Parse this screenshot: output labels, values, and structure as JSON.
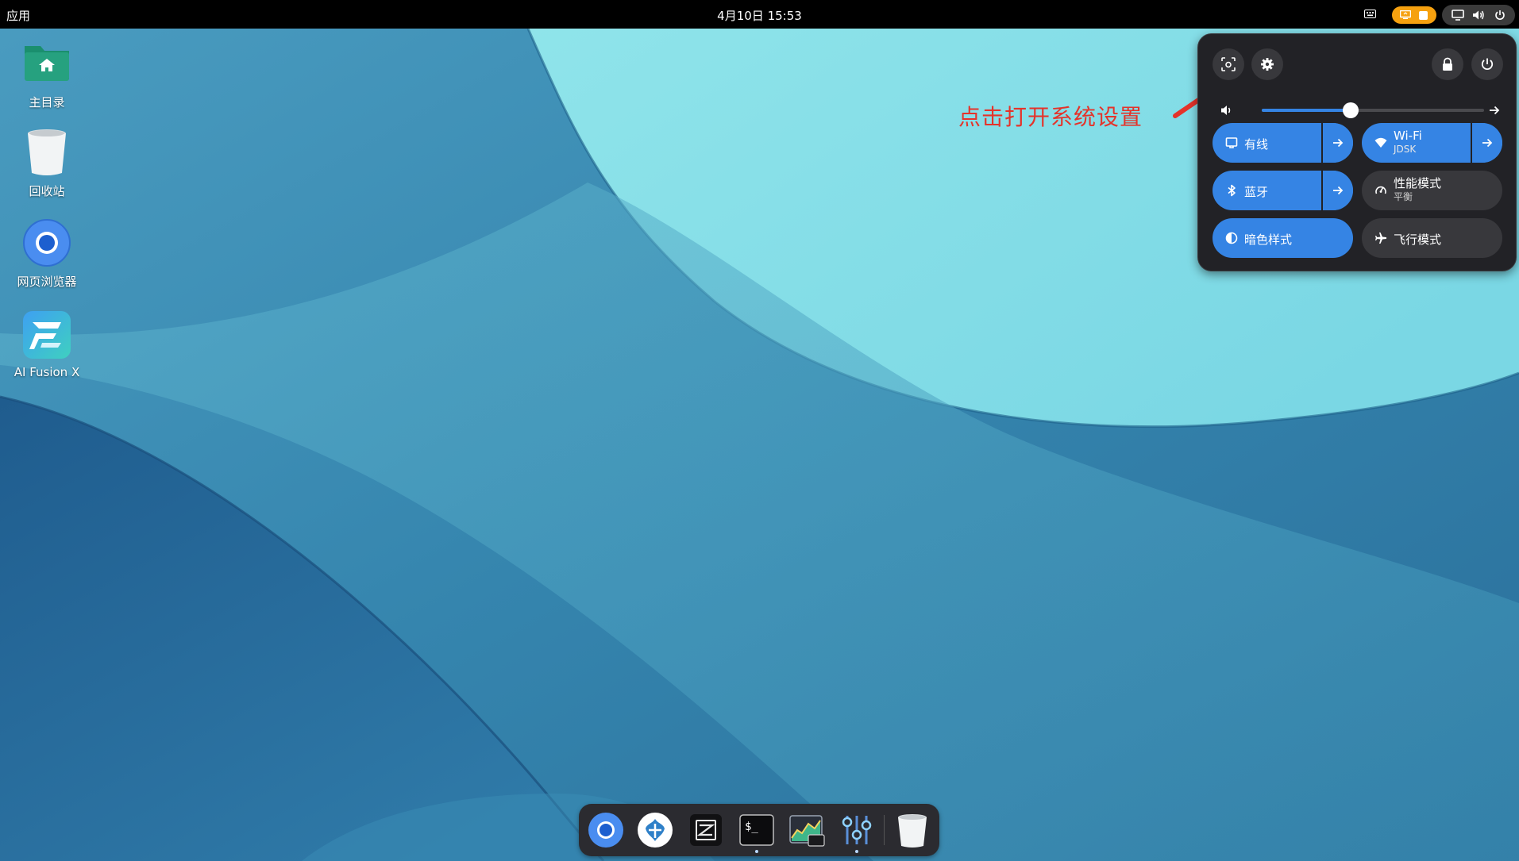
{
  "topbar": {
    "apps_label": "应用",
    "clock": "4月10日  15:53",
    "indicators": [
      "keyboard-icon",
      "screen-share-icon",
      "record-stop-icon",
      "display-icon",
      "volume-icon",
      "power-icon"
    ],
    "accent_color": "#f6a10f"
  },
  "desktop": {
    "icons": [
      {
        "label": "主目录",
        "icon": "home-folder-icon"
      },
      {
        "label": "回收站",
        "icon": "trash-icon"
      },
      {
        "label": "网页浏览器",
        "icon": "chrome-icon"
      },
      {
        "label": "AI Fusion X",
        "icon": "ai-fusion-x-icon"
      }
    ]
  },
  "quick_settings": {
    "buttons": [
      "screenshot-icon",
      "settings-icon",
      "lock-icon",
      "power-icon"
    ],
    "volume_level": 0.4,
    "tiles": [
      {
        "label": "有线",
        "sub": "",
        "on": true,
        "icon": "wired-network-icon",
        "has_arrow": true
      },
      {
        "label": "Wi-Fi",
        "sub": "JDSK",
        "on": true,
        "icon": "wifi-icon",
        "has_arrow": true
      },
      {
        "label": "蓝牙",
        "sub": "",
        "on": true,
        "icon": "bluetooth-icon",
        "has_arrow": true
      },
      {
        "label": "性能模式",
        "sub": "平衡",
        "on": false,
        "icon": "power-mode-icon",
        "has_arrow": false
      },
      {
        "label": "暗色样式",
        "sub": "",
        "on": true,
        "icon": "dark-style-icon",
        "has_arrow": false
      },
      {
        "label": "飞行模式",
        "sub": "",
        "on": false,
        "icon": "airplane-icon",
        "has_arrow": false
      }
    ],
    "accent_color": "#3584e4"
  },
  "annotation": {
    "text": "点击打开系统设置",
    "color": "#e5332a"
  },
  "dock": {
    "items": [
      "chrome-icon",
      "vscodium-icon",
      "zed-editor-icon",
      "terminal-icon",
      "system-monitor-icon",
      "mixer-icon",
      "trash-icon"
    ],
    "terminal_text": "$_"
  }
}
